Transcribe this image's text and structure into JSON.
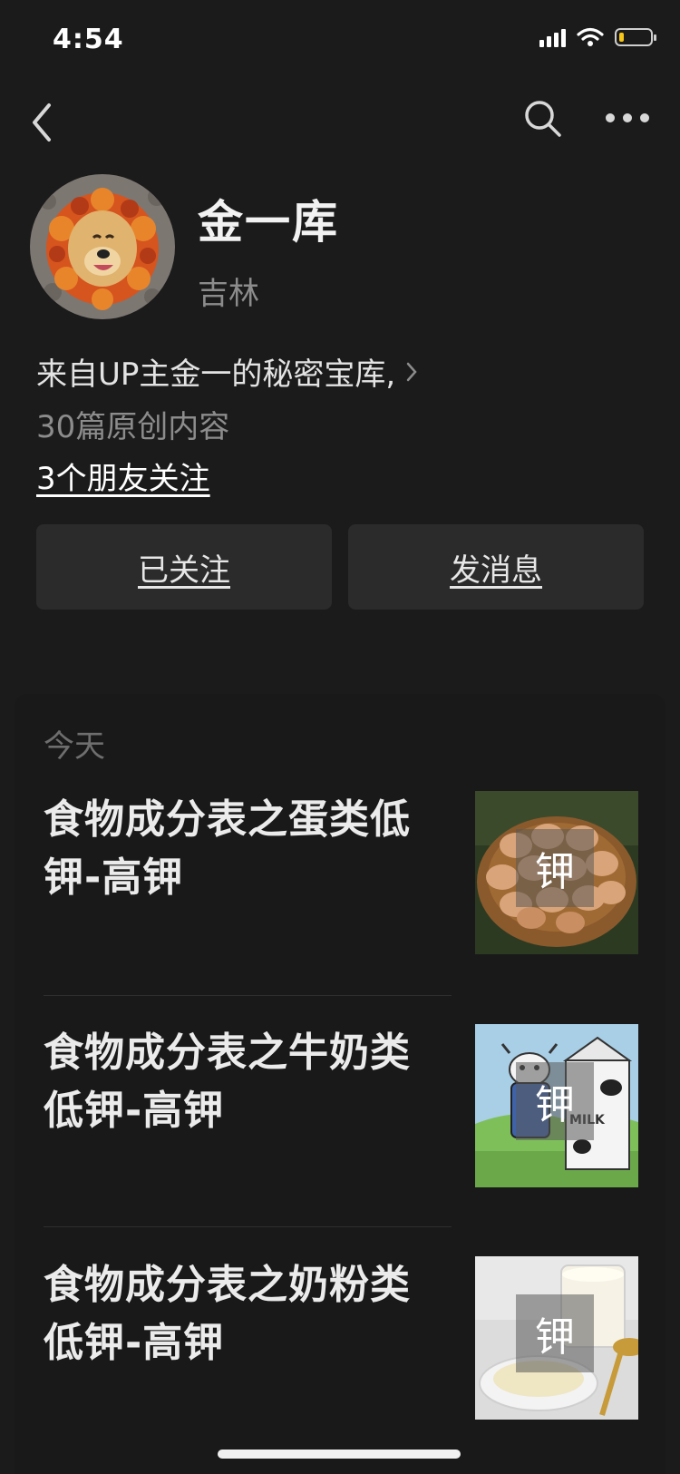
{
  "status_bar": {
    "time": "4:54"
  },
  "profile": {
    "name": "金一库",
    "region": "吉林",
    "bio": "来自UP主金一的秘密宝库,",
    "article_count": "30篇原创内容",
    "friends_following": "3个朋友关注"
  },
  "actions": {
    "follow_label": "已关注",
    "message_label": "发消息"
  },
  "feed": {
    "section_label": "今天",
    "items": [
      {
        "title": "食物成分表之蛋类低钾-高钾",
        "badge": "钾"
      },
      {
        "title": "食物成分表之牛奶类低钾-高钾",
        "badge": "钾"
      },
      {
        "title": "食物成分表之奶粉类低钾-高钾",
        "badge": "钾"
      }
    ]
  },
  "thumb_texts": {
    "milk": "MILK"
  },
  "colors": {
    "background": "#1b1b1b",
    "button": "#2b2b2b",
    "muted_text": "#8c8c8c",
    "battery": "#f5c518"
  },
  "icons": [
    "signal-icon",
    "wifi-icon",
    "battery-icon",
    "back-icon",
    "search-icon",
    "more-icon",
    "chevron-right-icon"
  ]
}
